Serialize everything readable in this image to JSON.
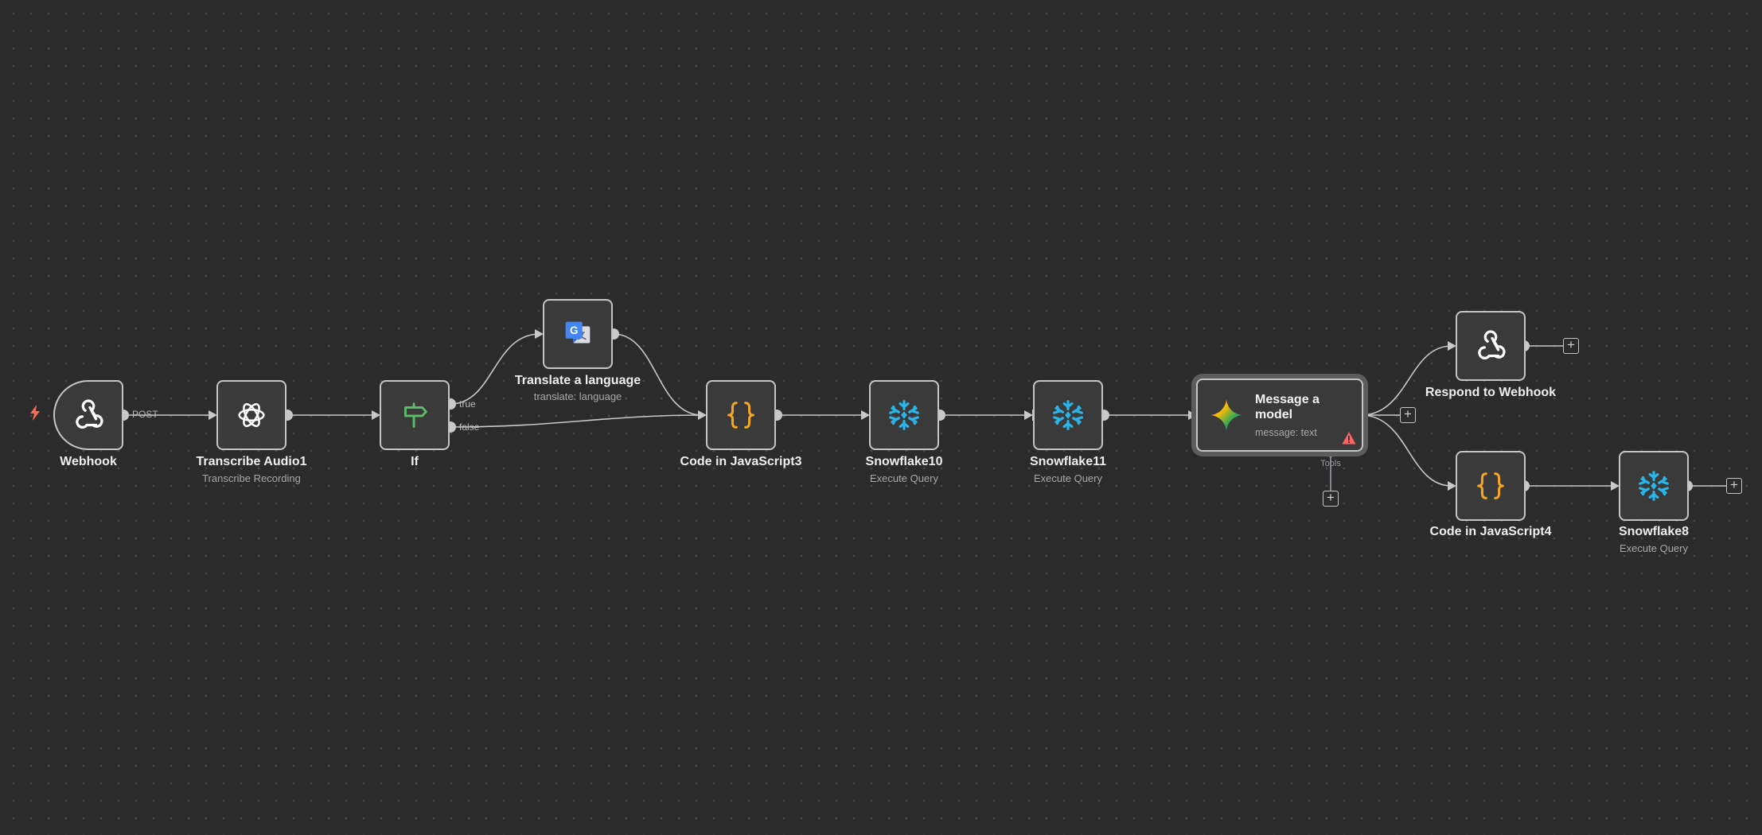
{
  "trigger_icon": "lightning-bolt-icon",
  "accent_trigger": "#ff6d5a",
  "nodes": {
    "webhook": {
      "name": "Webhook",
      "icon": "webhook-icon"
    },
    "transcribe": {
      "name": "Transcribe Audio1",
      "subtitle": "Transcribe Recording",
      "icon": "openai-icon"
    },
    "if": {
      "name": "If",
      "icon": "signpost-icon"
    },
    "translate": {
      "name": "Translate a language",
      "subtitle": "translate: language",
      "icon": "google-translate-icon"
    },
    "code3": {
      "name": "Code in JavaScript3",
      "icon": "braces-icon"
    },
    "snowflake10": {
      "name": "Snowflake10",
      "subtitle": "Execute Query",
      "icon": "snowflake-icon"
    },
    "snowflake11": {
      "name": "Snowflake11",
      "subtitle": "Execute Query",
      "icon": "snowflake-icon"
    },
    "message_model": {
      "name": "Message a model",
      "subtitle": "message: text",
      "icon": "gemini-icon",
      "warning_icon": "warning-triangle-icon"
    },
    "respond": {
      "name": "Respond to Webhook",
      "icon": "webhook-icon"
    },
    "code4": {
      "name": "Code in JavaScript4",
      "icon": "braces-icon"
    },
    "snowflake8": {
      "name": "Snowflake8",
      "subtitle": "Execute Query",
      "icon": "snowflake-icon"
    }
  },
  "edge_labels": {
    "post": "POST",
    "true": "true",
    "false": "false",
    "tools": "Tools"
  },
  "plus_symbol": "+"
}
